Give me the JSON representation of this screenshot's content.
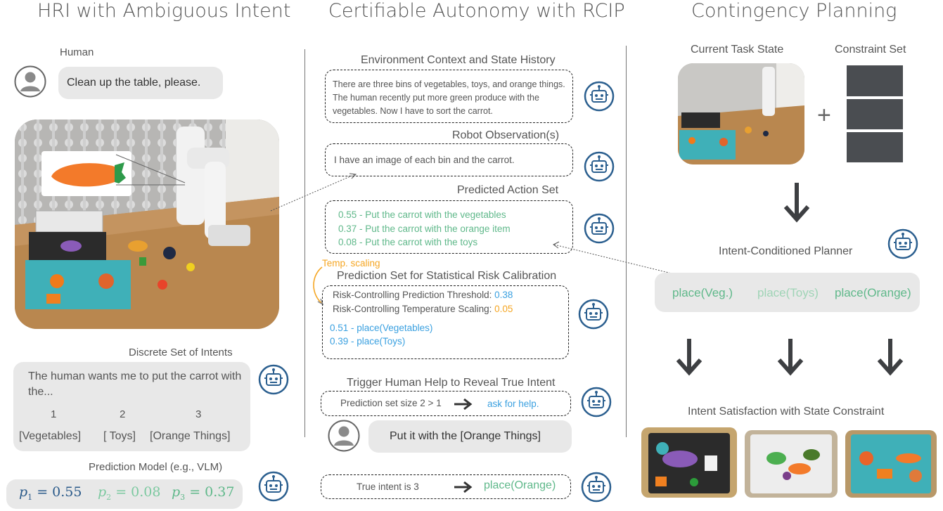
{
  "titles": {
    "left": "HRI with Ambiguous Intent",
    "middle": "Certifiable Autonomy with RCIP",
    "right": "Contingency Planning"
  },
  "left": {
    "human_label": "Human",
    "human_utterance": "Clean up the table, please.",
    "intents_title": "Discrete Set of Intents",
    "intents_prompt": "The human wants me to put the carrot with the...",
    "intents": [
      {
        "num": "1",
        "label": "[Vegetables]"
      },
      {
        "num": "2",
        "label": "[ Toys]"
      },
      {
        "num": "3",
        "label": "[Orange Things]"
      }
    ],
    "prediction_title": "Prediction Model (e.g., VLM)",
    "probs": [
      {
        "sym": "p",
        "sub": "1",
        "val": "= 0.55"
      },
      {
        "sym": "p",
        "sub": "2",
        "val": "= 0.08"
      },
      {
        "sym": "p",
        "sub": "3",
        "val": "= 0.37"
      }
    ]
  },
  "middle": {
    "env_title": "Environment Context and State History",
    "env_text": "There are three bins of vegetables, toys, and orange things. The human recently put more green produce with the vegetables. Now I have to sort the carrot.",
    "obs_title": "Robot Observation(s)",
    "obs_text": "I have an image of each bin and the carrot.",
    "action_title": "Predicted Action Set",
    "actions": [
      "0.55 - Put the carrot with the vegetables",
      "0.37 - Put the carrot with the orange item",
      "0.08 - Put the carrot with the toys"
    ],
    "temp_label": "Temp. scaling",
    "pset_title": "Prediction Set for Statistical Risk Calibration",
    "threshold_label": "Risk-Controlling Prediction Threshold:",
    "threshold_value": "0.38",
    "temp_scaling_label": "Risk-Controlling Temperature Scaling:",
    "temp_scaling_value": "0.05",
    "pset_items": [
      "0.51 - place(Vegetables)",
      "0.39 - place(Toys)"
    ],
    "help_title": "Trigger Human Help to Reveal True Intent",
    "help_text": "Prediction set size 2 > 1",
    "help_action": "ask for help.",
    "human_reply": "Put it with the [Orange Things]",
    "true_intent_text": "True intent is 3",
    "true_intent_action": "place(Orange)"
  },
  "right": {
    "task_state_label": "Current Task State",
    "constraint_label": "Constraint Set",
    "plus": "+",
    "planner_label": "Intent-Conditioned Planner",
    "plans": [
      "place(Veg.)",
      "place(Toys)",
      "place(Orange)"
    ],
    "satisfaction_label": "Intent Satisfaction with State Constraint"
  },
  "colors": {
    "green": "#5fb88a",
    "light_green": "#9fd4b6",
    "blue": "#3aa0e0",
    "orange": "#f5a623",
    "robot_blue": "#2b5f8f"
  }
}
